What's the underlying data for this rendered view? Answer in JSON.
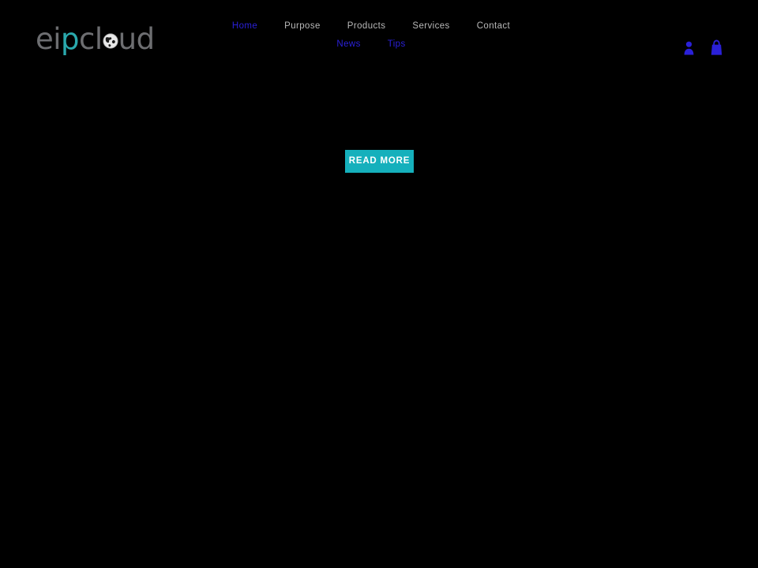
{
  "page": {
    "background_color": "#000000",
    "accent_color": "#15b0bc",
    "link_visited_color": "#2a20d8",
    "nav_text_color": "#b9b9b9"
  },
  "header": {
    "logo": {
      "name": "eipcloud",
      "segment_1": "ei",
      "segment_2": "p",
      "segment_3": "cl",
      "globe_icon": "globe-icon",
      "segment_4": "ud",
      "gray_color": "#6d6e71",
      "teal_color": "#2aa9ad"
    },
    "nav": {
      "row1": [
        {
          "label": "Home",
          "state": "visited"
        },
        {
          "label": "Purpose",
          "state": "default"
        },
        {
          "label": "Products",
          "state": "default"
        },
        {
          "label": "Services",
          "state": "default"
        },
        {
          "label": "Contact",
          "state": "default"
        }
      ],
      "row2": [
        {
          "label": "News",
          "state": "visited"
        },
        {
          "label": "Tips",
          "state": "visited"
        }
      ]
    },
    "icons": [
      {
        "name": "user-account-icon",
        "color": "#2a20d8"
      },
      {
        "name": "shopping-bag-icon",
        "color": "#2a20d8"
      }
    ]
  },
  "hero": {
    "read_more_label": "READ MORE"
  }
}
